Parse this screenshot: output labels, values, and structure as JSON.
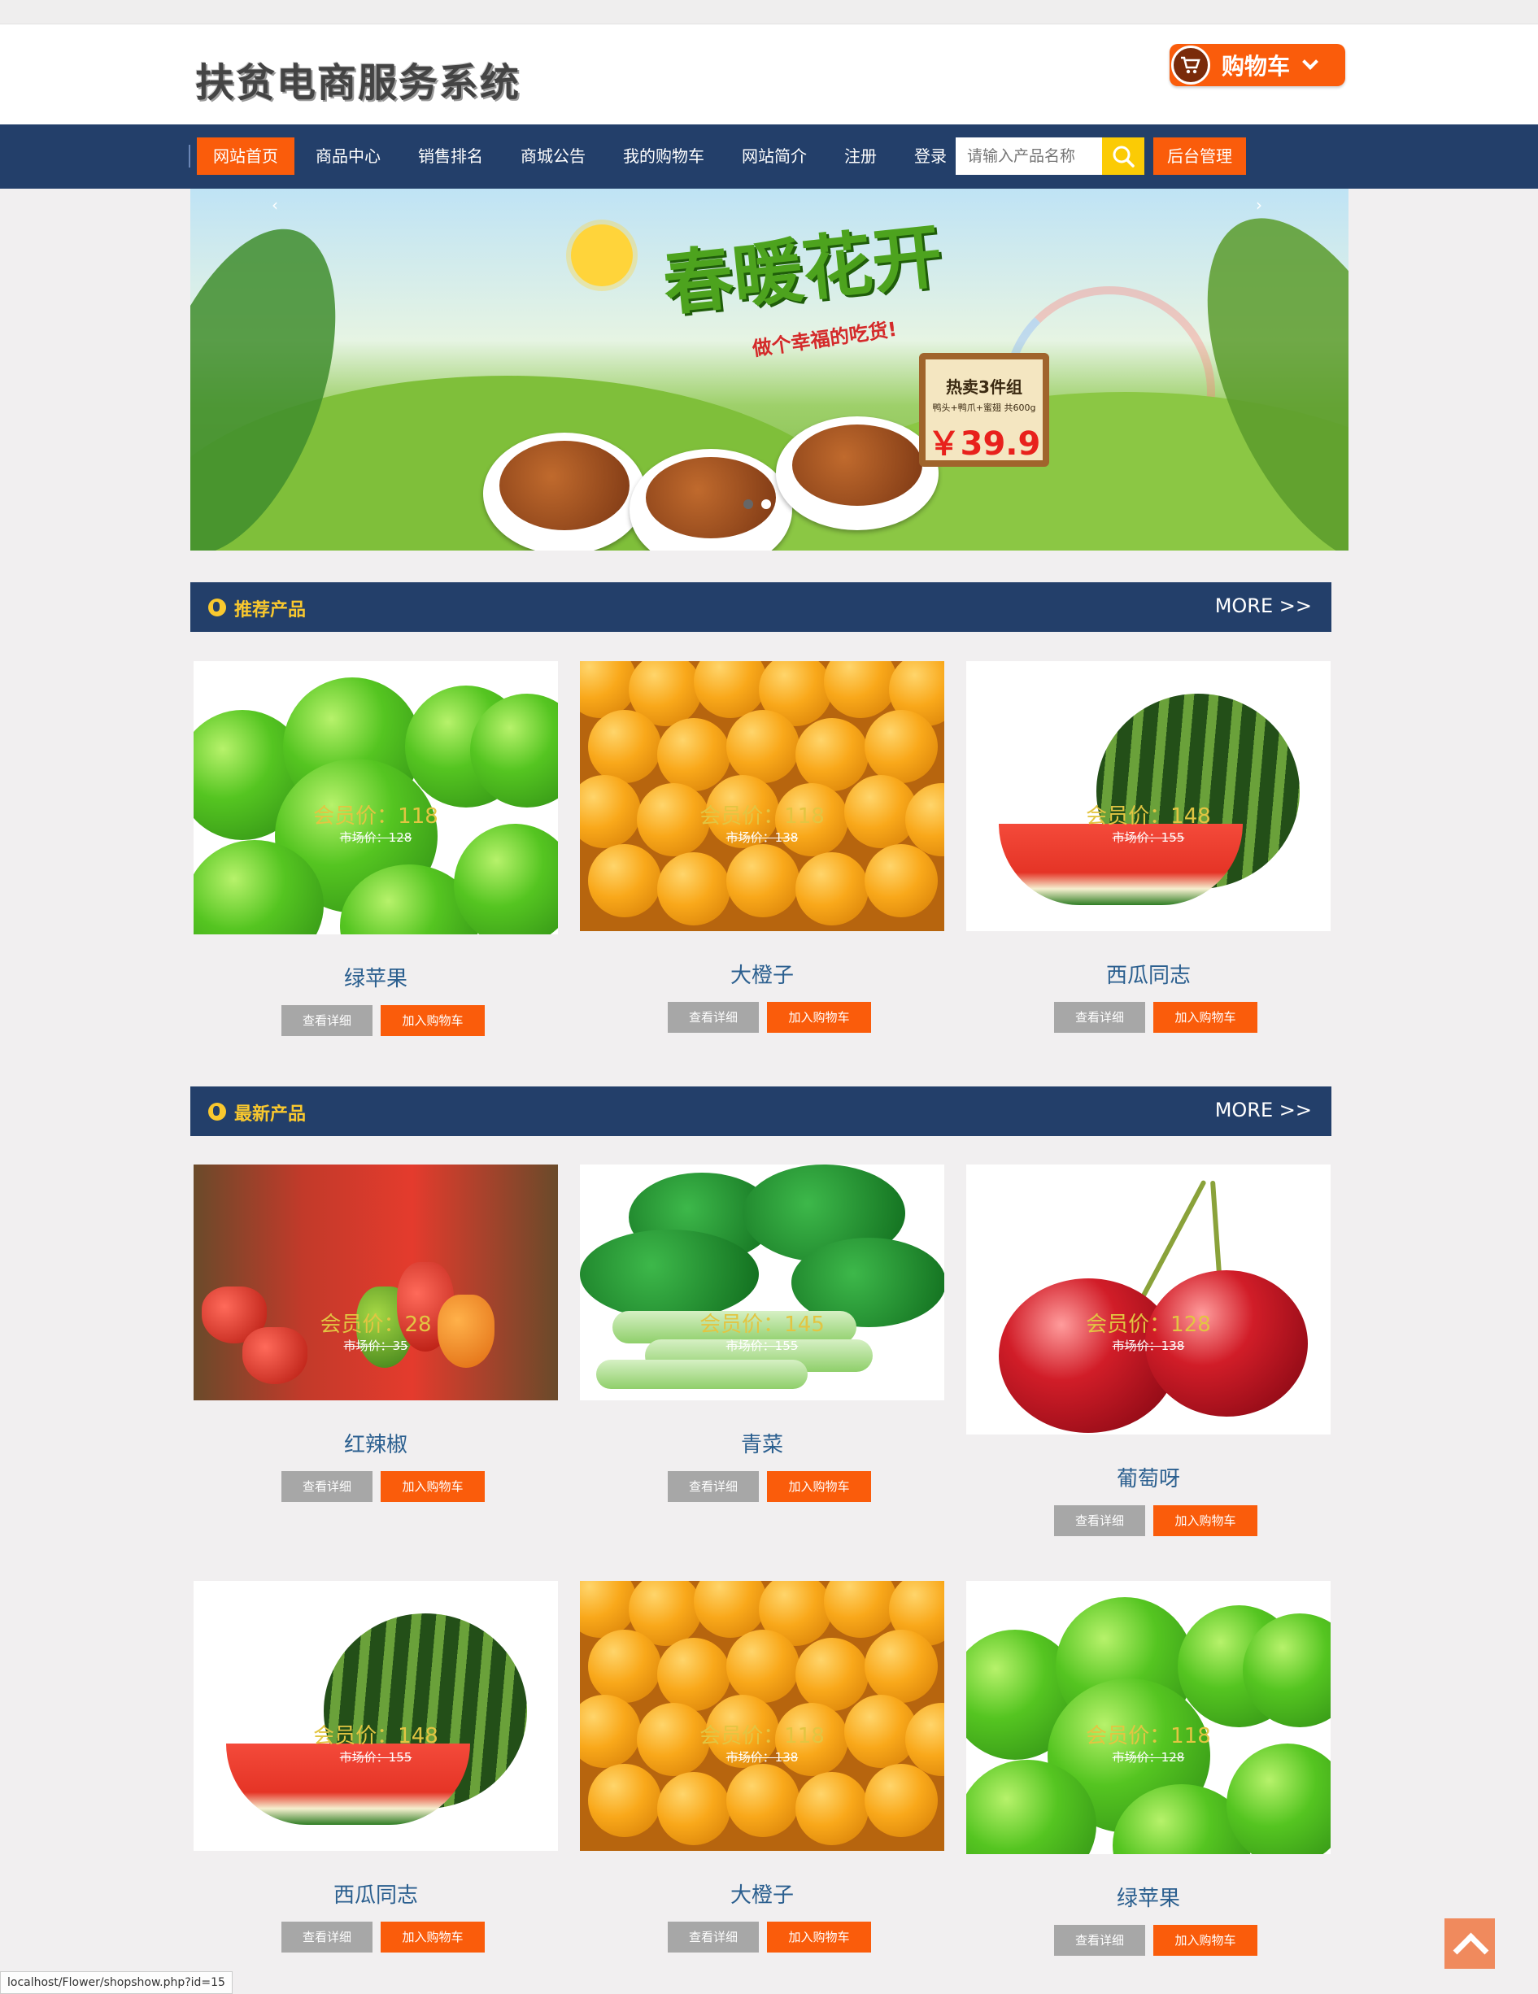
{
  "header": {
    "logo_text": "扶贫电商服务系统",
    "cart_label": "购物车"
  },
  "nav": {
    "items": [
      "网站首页",
      "商品中心",
      "销售排名",
      "商城公告",
      "我的购物车",
      "网站简介",
      "注册",
      "登录"
    ],
    "search_placeholder": "请输入产品名称",
    "admin_label": "后台管理"
  },
  "banner": {
    "title": "春暖花开",
    "slogan": "做个幸福的吃货!",
    "sign_title": "热卖3件组",
    "sign_sub": "鸭头+鸭爪+蜜翅 共600g",
    "sign_price": "￥39.9",
    "prev": "‹",
    "next": "›"
  },
  "sections": {
    "recommended": {
      "title": "推荐产品",
      "more": "MORE >>"
    },
    "newest": {
      "title": "最新产品",
      "more": "MORE >>"
    }
  },
  "buttons": {
    "detail": "查看详细",
    "cart": "加入购物车"
  },
  "products": {
    "recommended": [
      {
        "name": "绿苹果",
        "price": "会员价：118",
        "market": "市场价：128",
        "image": "green-apples"
      },
      {
        "name": "大橙子",
        "price": "会员价：118",
        "market": "市场价：138",
        "image": "oranges"
      },
      {
        "name": "西瓜同志",
        "price": "会员价：148",
        "market": "市场价：155",
        "image": "watermelon"
      }
    ],
    "newest": [
      {
        "name": "红辣椒",
        "price": "会员价：28",
        "market": "市场价：35",
        "image": "red-peppers"
      },
      {
        "name": "青菜",
        "price": "会员价：145",
        "market": "市场价：155",
        "image": "bok-choy"
      },
      {
        "name": "葡萄呀",
        "price": "会员价：128",
        "market": "市场价：138",
        "image": "cherries"
      },
      {
        "name": "西瓜同志",
        "price": "会员价：148",
        "market": "市场价：155",
        "image": "watermelon"
      },
      {
        "name": "大橙子",
        "price": "会员价：118",
        "market": "市场价：138",
        "image": "oranges"
      },
      {
        "name": "绿苹果",
        "price": "会员价：118",
        "market": "市场价：128",
        "image": "green-apples"
      }
    ]
  },
  "status_bar": "localhost/Flower/shopshow.php?id=15",
  "colors": {
    "nav": "#233f6a",
    "accent": "#fa5c0b",
    "search_btn": "#fbcb05",
    "section_title": "#f9c82e",
    "product_name": "#2b5f8f"
  }
}
